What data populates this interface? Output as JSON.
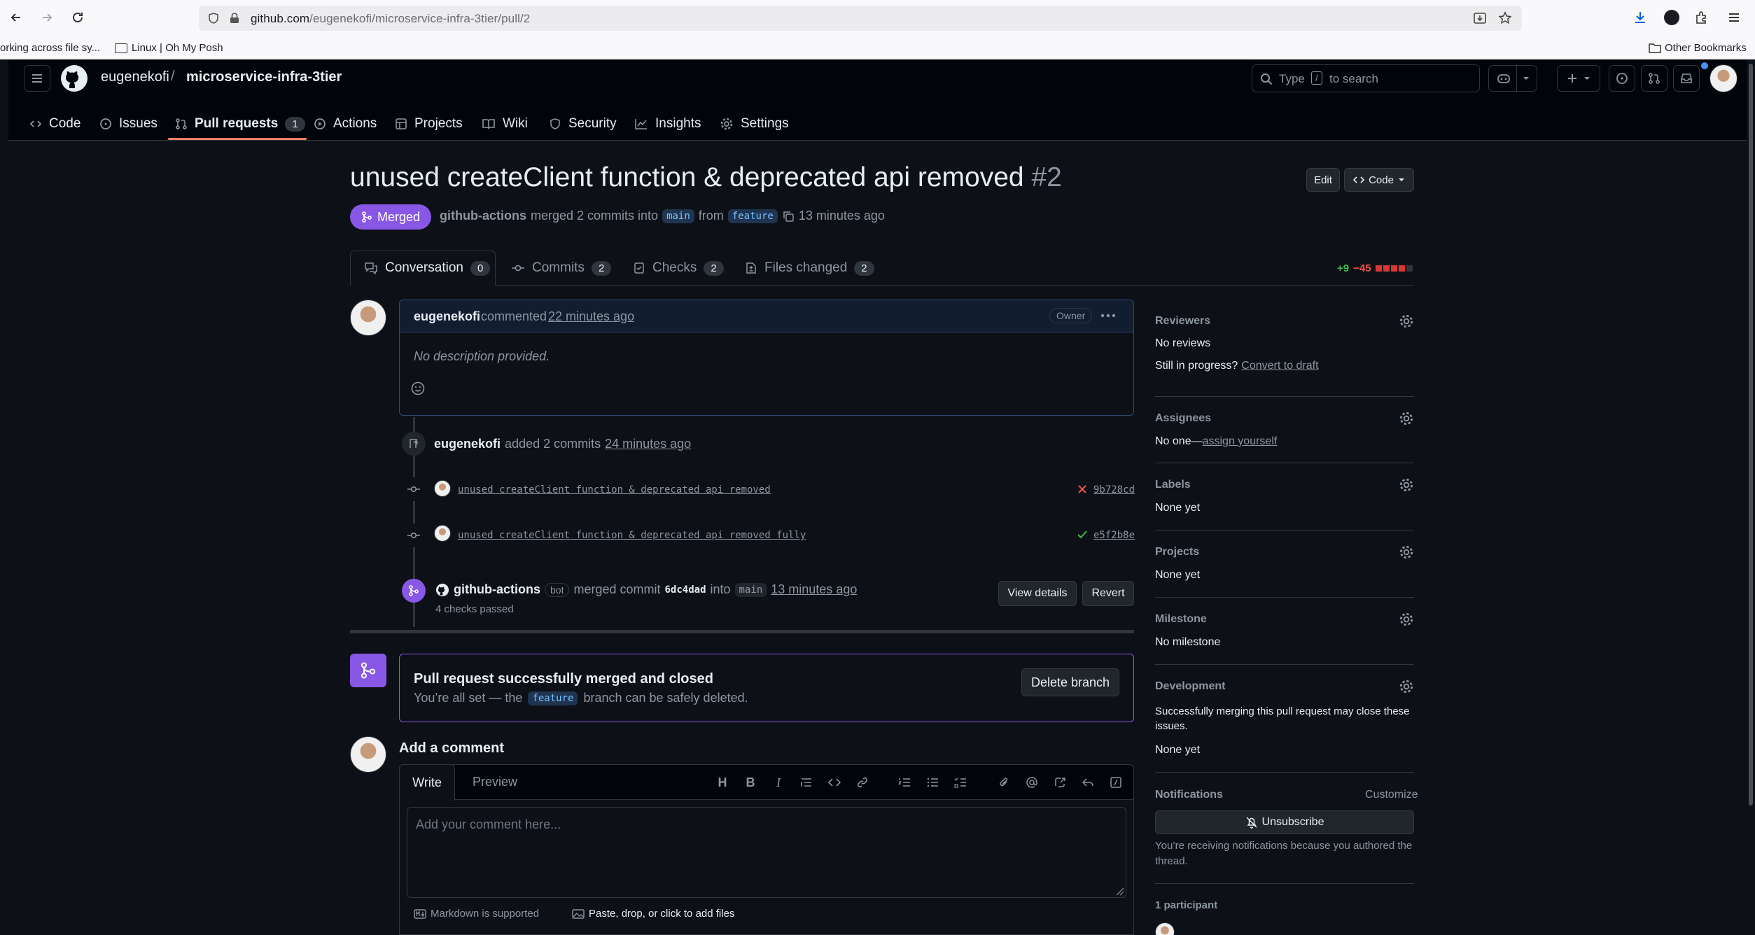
{
  "browser": {
    "url_host": "github.com",
    "url_path": "/eugenekofi/microservice-infra-3tier/pull/2",
    "bookmarks": [
      "orking across file sy...",
      "Linux | Oh My Posh"
    ],
    "other_bookmarks": "Other Bookmarks"
  },
  "repo": {
    "owner": "eugenekofi",
    "separator": "/",
    "name": "microservice-infra-3tier",
    "search_placeholder_pre": "Type",
    "search_key": "/",
    "search_placeholder_post": "to search"
  },
  "repo_tabs": [
    {
      "label": "Code",
      "icon": "code-icon"
    },
    {
      "label": "Issues",
      "icon": "issue-icon"
    },
    {
      "label": "Pull requests",
      "icon": "pull-request-icon",
      "count": "1",
      "active": true
    },
    {
      "label": "Actions",
      "icon": "play-icon"
    },
    {
      "label": "Projects",
      "icon": "table-icon"
    },
    {
      "label": "Wiki",
      "icon": "book-icon"
    },
    {
      "label": "Security",
      "icon": "shield-icon"
    },
    {
      "label": "Insights",
      "icon": "graph-icon"
    },
    {
      "label": "Settings",
      "icon": "gear-icon"
    }
  ],
  "pr": {
    "title": "unused createClient function & deprecated api removed",
    "number": "#2",
    "edit_label": "Edit",
    "code_label": "Code",
    "state": "Merged",
    "merger": "github-actions",
    "merged_text": "merged 2 commits into",
    "base": "main",
    "from_text": "from",
    "head": "feature",
    "time": "13 minutes ago"
  },
  "pr_tabs": [
    {
      "label": "Conversation",
      "count": "0",
      "active": true
    },
    {
      "label": "Commits",
      "count": "2"
    },
    {
      "label": "Checks",
      "count": "2"
    },
    {
      "label": "Files changed",
      "count": "2"
    }
  ],
  "diffstat": {
    "additions": "+9",
    "deletions": "−45"
  },
  "comment": {
    "author": "eugenekofi",
    "action": "commented",
    "time": "22 minutes ago",
    "badge": "Owner",
    "body": "No description provided."
  },
  "commits_event": {
    "author": "eugenekofi",
    "action": "added 2 commits",
    "time": "24 minutes ago",
    "commits": [
      {
        "message": "unused createClient function & deprecated api removed",
        "sha": "9b728cd",
        "status": "fail"
      },
      {
        "message": "unused createClient function & deprecated api removed fully",
        "sha": "e5f2b8e",
        "status": "pass"
      }
    ]
  },
  "merge_event": {
    "actor": "github-actions",
    "bot": "bot",
    "action": "merged commit",
    "sha": "6dc4dad",
    "into": "into",
    "branch": "main",
    "time": "13 minutes ago",
    "checks": "4 checks passed",
    "view_details": "View details",
    "revert": "Revert"
  },
  "merged_box": {
    "title": "Pull request successfully merged and closed",
    "text_pre": "You’re all set — the",
    "branch": "feature",
    "text_post": "branch can be safely deleted.",
    "delete_label": "Delete branch"
  },
  "add_comment": {
    "heading": "Add a comment",
    "write": "Write",
    "preview": "Preview",
    "placeholder": "Add your comment here...",
    "markdown": "Markdown is supported",
    "attach": "Paste, drop, or click to add files"
  },
  "sidebar": {
    "reviewers": {
      "label": "Reviewers",
      "value": "No reviews",
      "progress_q": "Still in progress?",
      "convert": "Convert to draft"
    },
    "assignees": {
      "label": "Assignees",
      "value_pre": "No one—",
      "assign": "assign yourself"
    },
    "labels": {
      "label": "Labels",
      "value": "None yet"
    },
    "projects": {
      "label": "Projects",
      "value": "None yet"
    },
    "milestone": {
      "label": "Milestone",
      "value": "No milestone"
    },
    "development": {
      "label": "Development",
      "text": "Successfully merging this pull request may close these issues.",
      "value": "None yet"
    },
    "notifications": {
      "label": "Notifications",
      "customize": "Customize",
      "button": "Unsubscribe",
      "reason": "You’re receiving notifications because you authored the thread."
    },
    "participants": "1 participant"
  },
  "colors": {
    "merged": "#8957e5",
    "accent_tab": "#f78166",
    "add": "#3fb950",
    "del": "#f85149"
  }
}
